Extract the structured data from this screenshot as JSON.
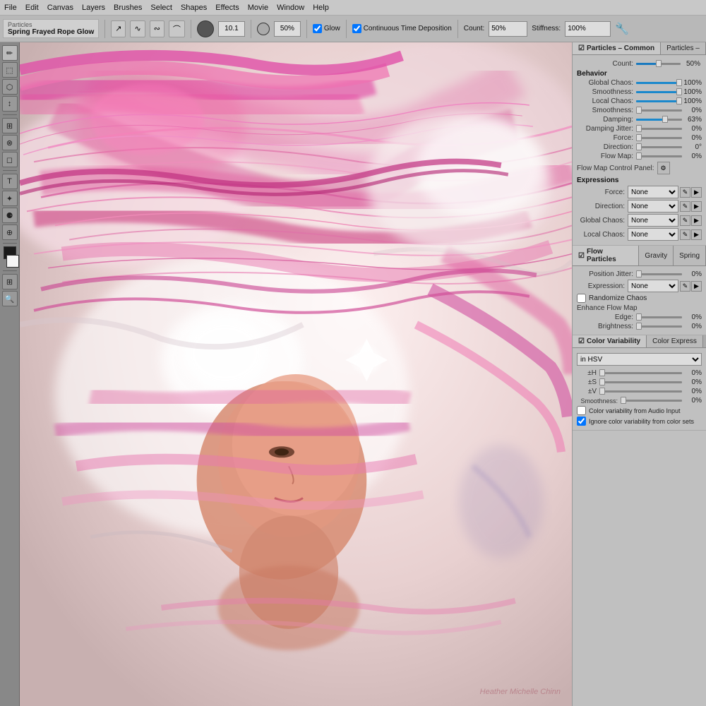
{
  "menubar": {
    "items": [
      "File",
      "Edit",
      "Canvas",
      "Layers",
      "Brushes",
      "Select",
      "Shapes",
      "Effects",
      "Movie",
      "Window",
      "Help"
    ]
  },
  "toolbar": {
    "brush_category": "Particles",
    "brush_name": "Spring Frayed Rope Glow",
    "size_value": "10.1",
    "opacity_value": "50%",
    "glow_label": "Glow",
    "glow_checked": true,
    "continuous_label": "Continuous Time Deposition",
    "continuous_checked": true,
    "count_label": "Count:",
    "count_value": "50%",
    "stiffness_label": "Stiffness:",
    "stiffness_value": "100%"
  },
  "left_tools": {
    "tools": [
      "✏",
      "🔲",
      "⬡",
      "↕",
      "⊕",
      "⊗",
      "○",
      "T",
      "✦",
      "⚙"
    ]
  },
  "canvas": {
    "watermark": "Heather Michelle Chinn"
  },
  "right_panel": {
    "common_tab": "Particles – Common",
    "particles_tab": "Particles –",
    "count_label": "Count:",
    "count_value": "50%",
    "count_pct": 50,
    "behavior_title": "Behavior",
    "params": [
      {
        "label": "Global Chaos:",
        "value": "100%",
        "pct": 100
      },
      {
        "label": "Smoothness:",
        "value": "100%",
        "pct": 100
      },
      {
        "label": "Local Chaos:",
        "value": "100%",
        "pct": 100
      },
      {
        "label": "Smoothness:",
        "value": "0%",
        "pct": 0
      },
      {
        "label": "Damping:",
        "value": "63%",
        "pct": 63
      },
      {
        "label": "Damping Jitter:",
        "value": "0%",
        "pct": 0
      },
      {
        "label": "Force:",
        "value": "0%",
        "pct": 0
      },
      {
        "label": "Direction:",
        "value": "0°",
        "pct": 0
      },
      {
        "label": "Flow Map:",
        "value": "0%",
        "pct": 0
      }
    ],
    "flow_map_control": "Flow Map Control Panel:",
    "expressions_title": "Expressions",
    "expressions": [
      {
        "label": "Force:",
        "value": "None"
      },
      {
        "label": "Direction:",
        "value": "None"
      },
      {
        "label": "Global Chaos:",
        "value": "None"
      },
      {
        "label": "Local Chaos:",
        "value": "None"
      }
    ],
    "flow_particles_tab": "Flow Particles",
    "gravity_tab": "Gravity",
    "spring_tab": "Spring",
    "position_jitter_label": "Position Jitter:",
    "position_jitter_value": "0%",
    "position_jitter_pct": 0,
    "expression_label": "Expression:",
    "expression_value": "None",
    "randomize_label": "Randomize Chaos",
    "enhance_title": "Enhance Flow Map",
    "edge_label": "Edge:",
    "edge_value": "0%",
    "edge_pct": 0,
    "brightness_label": "Brightness:",
    "brightness_value": "0%",
    "brightness_pct": 0,
    "color_variability_tab": "Color Variability",
    "color_express_tab": "Color Express",
    "in_hsv_label": "in HSV",
    "hsv_params": [
      {
        "label": "±H",
        "value": "0%",
        "pct": 0
      },
      {
        "label": "±S",
        "value": "0%",
        "pct": 0
      },
      {
        "label": "±V",
        "value": "0%",
        "pct": 0
      },
      {
        "label": "Smoothness:",
        "value": "0%",
        "pct": 0
      }
    ],
    "audio_input_label": "Color variability from Audio Input",
    "ignore_sets_label": "Ignore color variability from color sets",
    "audio_checked": false,
    "ignore_checked": true
  }
}
